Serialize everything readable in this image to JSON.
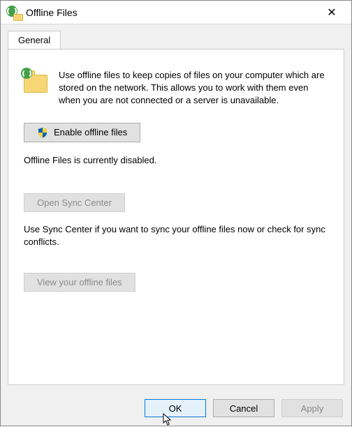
{
  "window": {
    "title": "Offline Files"
  },
  "tabs": {
    "general": "General"
  },
  "content": {
    "intro": "Use offline files to keep copies of files on your computer which are stored on the network.  This allows you to work with them even when you are not connected or a server is unavailable.",
    "enable_button": "Enable offline files",
    "status": "Offline Files is currently disabled.",
    "open_sync_center": "Open Sync Center",
    "sync_helper": "Use Sync Center if you want to sync your offline files now or check for sync conflicts.",
    "view_offline_files": "View your offline files"
  },
  "buttons": {
    "ok": "OK",
    "cancel": "Cancel",
    "apply": "Apply"
  }
}
